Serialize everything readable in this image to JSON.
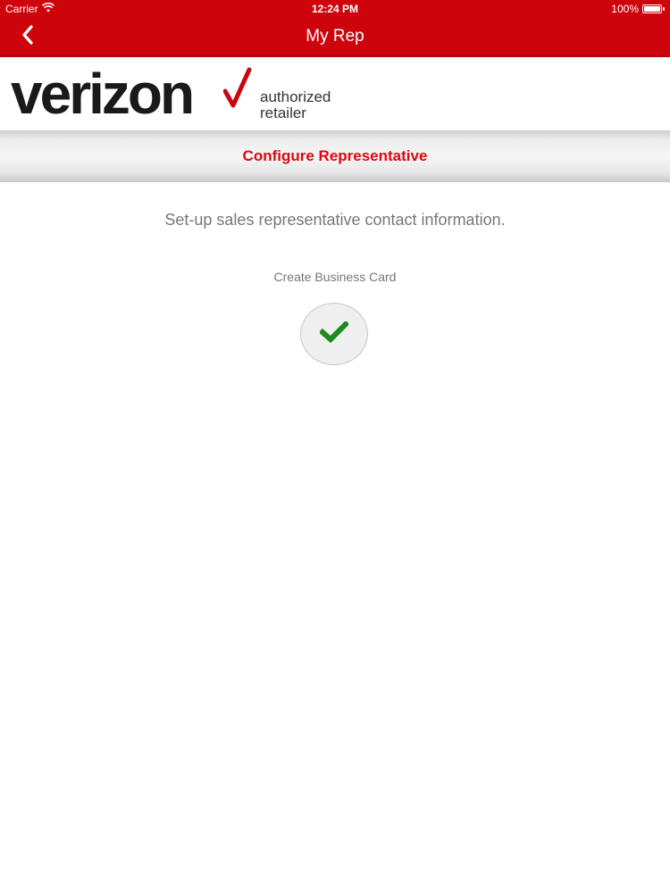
{
  "status_bar": {
    "carrier": "Carrier",
    "time": "12:24 PM",
    "battery": "100%"
  },
  "navbar": {
    "title": "My Rep",
    "back_icon": "chevron-left-icon"
  },
  "logo": {
    "word": "verizon",
    "sub_line1": "authorized",
    "sub_line2": "retailer"
  },
  "section": {
    "title": "Configure Representative"
  },
  "main": {
    "intro": "Set-up sales representative contact information.",
    "card_label": "Create Business Card",
    "card_button_icon": "checkmark-icon"
  },
  "colors": {
    "brand_red": "#cd040b",
    "section_title_red": "#e0060e",
    "check_green": "#1e8a1e"
  }
}
